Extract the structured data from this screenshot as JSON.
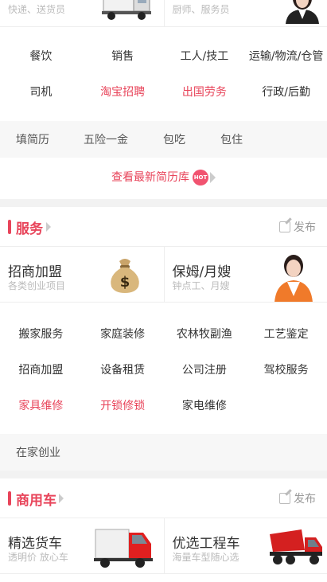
{
  "top_cards": [
    {
      "subtitle": "快递、送货员"
    },
    {
      "subtitle": "厨师、服务员"
    }
  ],
  "job_categories": [
    {
      "label": "餐饮",
      "highlight": false
    },
    {
      "label": "销售",
      "highlight": false
    },
    {
      "label": "工人/技工",
      "highlight": false
    },
    {
      "label": "运输/物流/仓管",
      "highlight": false
    },
    {
      "label": "司机",
      "highlight": false
    },
    {
      "label": "淘宝招聘",
      "highlight": true
    },
    {
      "label": "出国劳务",
      "highlight": true
    },
    {
      "label": "行政/后勤",
      "highlight": false
    }
  ],
  "job_tags": [
    "填简历",
    "五险一金",
    "包吃",
    "包住"
  ],
  "resume_link": {
    "label": "查看最新简历库",
    "badge": "HOT"
  },
  "service": {
    "title": "服务",
    "publish": "发布",
    "cards": [
      {
        "title": "招商加盟",
        "subtitle": "各类创业项目"
      },
      {
        "title": "保姆/月嫂",
        "subtitle": "钟点工、月嫂"
      }
    ],
    "categories": [
      {
        "label": "搬家服务",
        "highlight": false
      },
      {
        "label": "家庭装修",
        "highlight": false
      },
      {
        "label": "农林牧副渔",
        "highlight": false
      },
      {
        "label": "工艺鉴定",
        "highlight": false
      },
      {
        "label": "招商加盟",
        "highlight": false
      },
      {
        "label": "设备租赁",
        "highlight": false
      },
      {
        "label": "公司注册",
        "highlight": false
      },
      {
        "label": "驾校服务",
        "highlight": false
      },
      {
        "label": "家具维修",
        "highlight": true
      },
      {
        "label": "开锁修锁",
        "highlight": true
      },
      {
        "label": "家电维修",
        "highlight": false
      }
    ],
    "tags": [
      "在家创业"
    ]
  },
  "commercial": {
    "title": "商用车",
    "publish": "发布",
    "cards": [
      {
        "title": "精选货车",
        "subtitle": "透明价 放心车"
      },
      {
        "title": "优选工程车",
        "subtitle": "海量车型随心选"
      }
    ]
  },
  "colors": {
    "accent": "#e8445a",
    "muted": "#bbbbbb",
    "band": "#f7f7f7"
  }
}
